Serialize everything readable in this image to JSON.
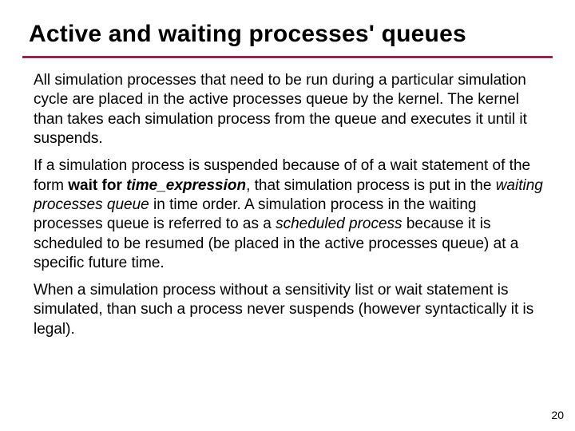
{
  "title": "Active and waiting processes' queues",
  "p1": "All simulation processes that need to be run during a particular simulation cycle are placed in the active processes queue by the kernel. The kernel than takes each simulation process from the queue and executes it until it suspends.",
  "p2a": "If a simulation process is suspended because of of a wait statement of the form ",
  "p2b_bold": "wait for ",
  "p2c_bolditalic": "time_expression",
  "p2d": ", that simulation process is put in the ",
  "p2e_italic": "waiting processes queue",
  "p2f": " in time order. A simulation process in the waiting processes queue is referred to as a ",
  "p2g_italic": "scheduled process",
  "p2h": " because it is scheduled to be resumed (be placed in the active processes queue) at a specific future time.",
  "p3": "When a simulation process without a sensitivity list or wait statement is simulated, than such a process never suspends (however syntactically it is legal).",
  "page_number": "20",
  "colors": {
    "rule": "#8f294b"
  }
}
